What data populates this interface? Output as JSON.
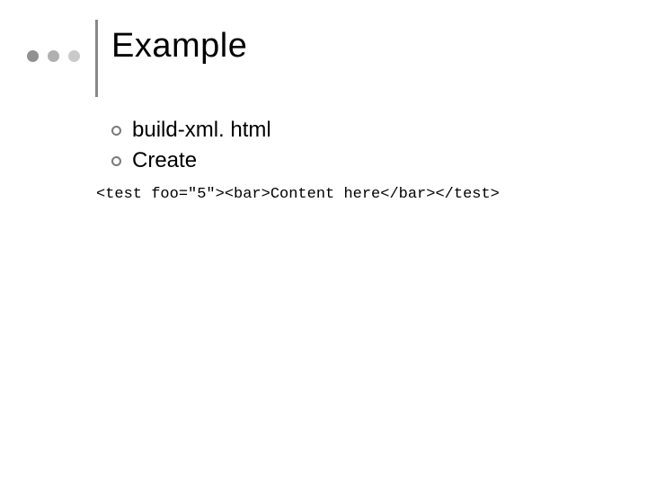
{
  "title": "Example",
  "bullets": [
    "build-xml. html",
    "Create"
  ],
  "code": "<test foo=\"5\"><bar>Content here</bar></test>"
}
